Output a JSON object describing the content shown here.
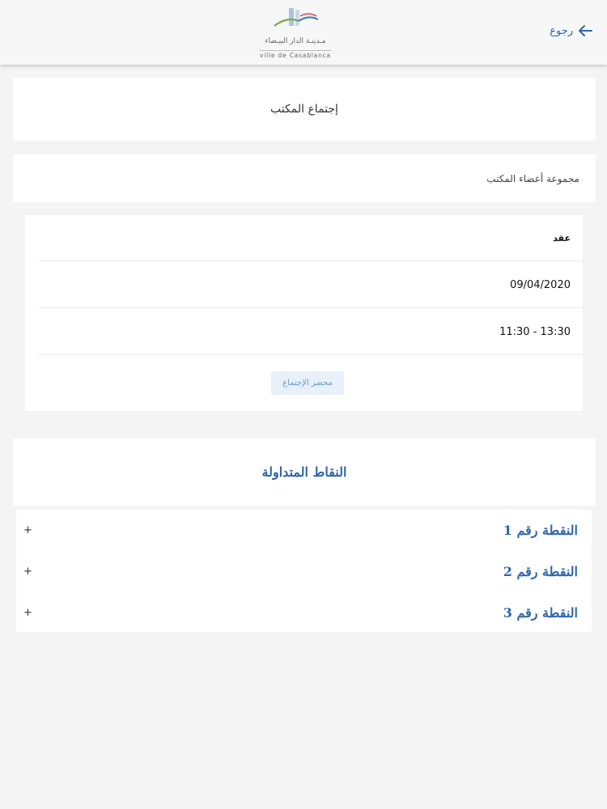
{
  "header": {
    "back_label": "رجوع",
    "logo_text_ar": "مـدينـة الدار البيـضاء",
    "logo_text_fr": "ville de Casablanca",
    "accent": "#2e66a8"
  },
  "meeting": {
    "title": "إجتماع المكتب",
    "group": "مجموعة أعضاء المكتب",
    "status": "عقد",
    "date": "09/04/2020",
    "time": "13:30 - 11:30",
    "minutes_button": "محضر الإجتماع"
  },
  "points": {
    "heading": "النقاط المتداولة",
    "items": [
      {
        "label": "النقطة رقم 1",
        "toggle": "+"
      },
      {
        "label": "النقطة رقم 2",
        "toggle": "+"
      },
      {
        "label": "النقطة رقم 3",
        "toggle": "+"
      }
    ]
  },
  "icons": {
    "back": "arrow-left-icon",
    "logo": "city-logo"
  }
}
